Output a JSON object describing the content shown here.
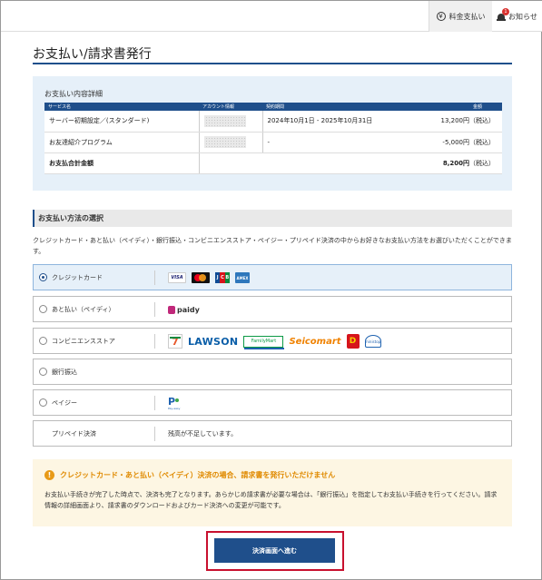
{
  "header": {
    "billing_label": "料金支払い",
    "billing_icon": "yen-circle-icon",
    "notice_label": "お知らせ",
    "notice_badge": "1"
  },
  "page": {
    "title": "お支払い/請求書発行"
  },
  "details": {
    "heading": "お支払い内容詳細",
    "columns": [
      "サービス名",
      "アカウント情報",
      "契約期間",
      "金額"
    ],
    "rows": [
      {
        "service": "サーバー初期設定／(スタンダード)",
        "period": "2024年10月1日 - 2025年10月31日",
        "amount": "13,200円（税込）"
      },
      {
        "service": "お友達紹介プログラム",
        "period": "-",
        "amount": "-5,000円（税込）"
      }
    ],
    "total_label": "お支払合計金額",
    "total_amount": "8,200円",
    "total_tax": "（税込）"
  },
  "method": {
    "heading": "お支払い方法の選択",
    "description": "クレジットカード・あと払い（ペイディ）・銀行振込・コンビニエンスストア・ペイジー・プリペイド決済の中からお好きなお支払い方法をお選びいただくことができます。",
    "options": [
      {
        "label": "クレジットカード",
        "selected": true,
        "logos": [
          "VISA",
          "MC",
          "JCB",
          "AMEX"
        ]
      },
      {
        "label": "あと払い（ペイディ）",
        "selected": false,
        "logos": [
          "paidy"
        ]
      },
      {
        "label": "コンビニエンスストア",
        "selected": false,
        "logos": [
          "7",
          "LAWSON",
          "FamilyMart",
          "Seicomart",
          "D",
          "ministop"
        ]
      },
      {
        "label": "銀行振込",
        "selected": false
      },
      {
        "label": "ペイジー",
        "selected": false,
        "logos": [
          "P",
          "Pay-easy"
        ]
      }
    ],
    "prepaid_label": "プリペイド決済",
    "prepaid_message": "残高が不足しています。"
  },
  "notice": {
    "title": "クレジットカード・あと払い（ペイディ）決済の場合、請求書を発行いただけません",
    "body": "お支払い手続きが完了した時点で、決済も完了となります。あらかじめ請求書が必要な場合は、「銀行振込」を指定してお支払い手続きを行ってください。請求情報の詳細画面より、請求書のダウンロードおよびカード決済への変更が可能です。"
  },
  "actions": {
    "submit_label": "決済画面へ進む"
  },
  "colors": {
    "primary": "#1f4f8b",
    "highlight": "#c8102e",
    "warning": "#e08a00"
  }
}
